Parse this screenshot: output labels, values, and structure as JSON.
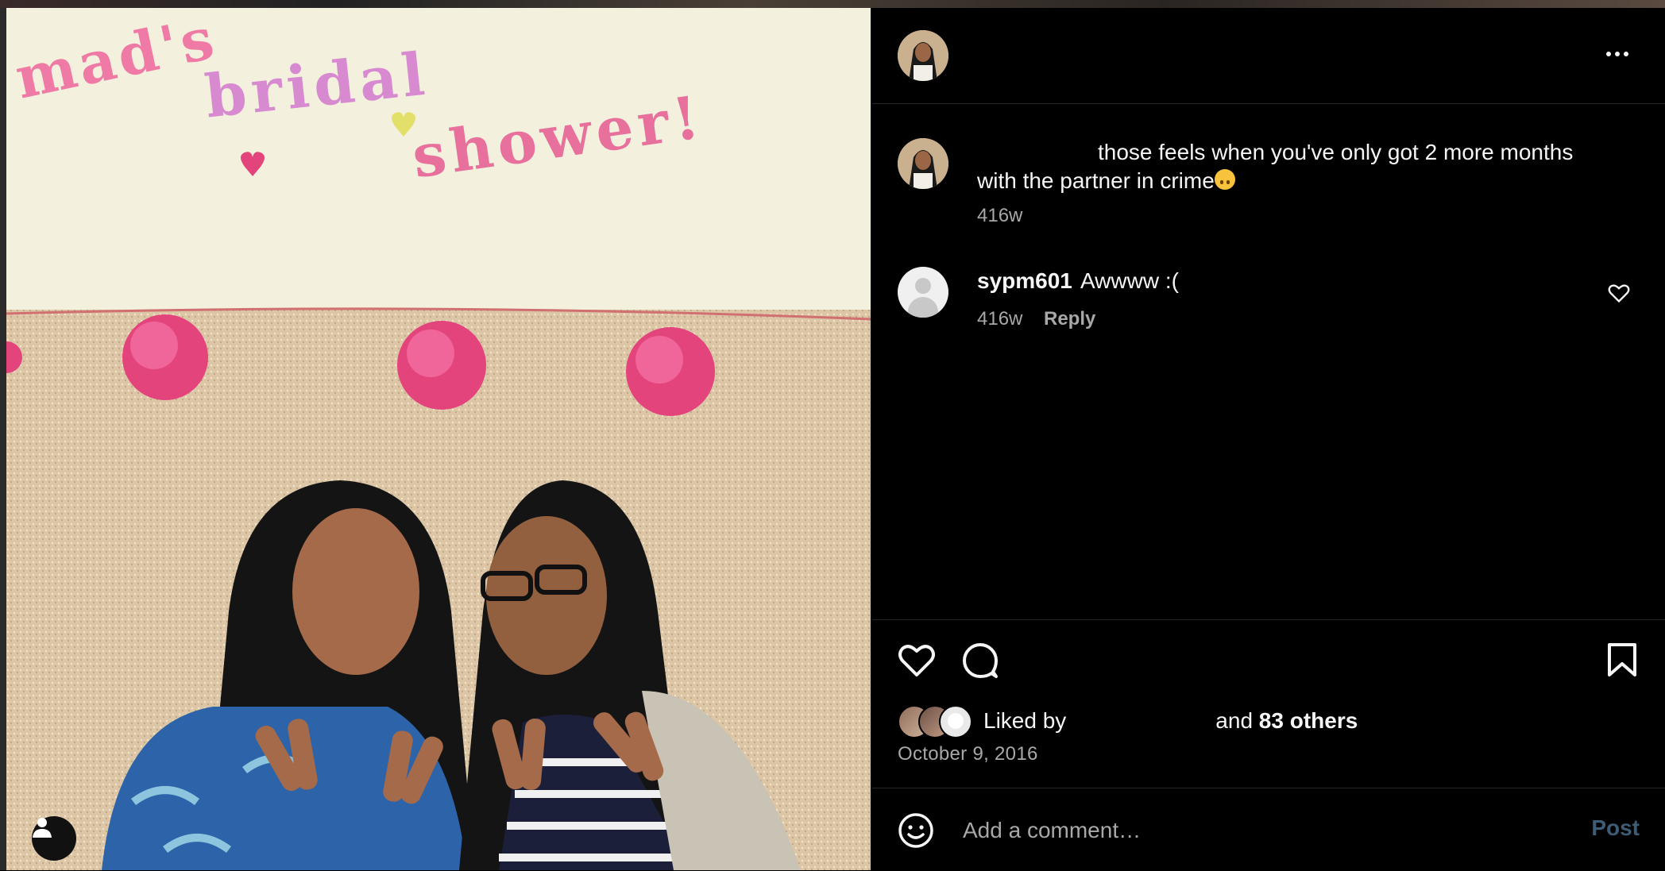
{
  "photo": {
    "banner_words": [
      "mad's",
      "bridal",
      "shower!"
    ],
    "owner_button_icon": "person-icon"
  },
  "post_header": {
    "avatar_icon": "profile-avatar",
    "more_icon": "more-options-icon"
  },
  "caption": {
    "text": "those feels when you've only got 2 more months with the partner in crime",
    "emoji": "upside-down-face",
    "time": "416w"
  },
  "comments": [
    {
      "username": "sypm601",
      "text": "Awwww :(",
      "time": "416w",
      "reply_label": "Reply"
    }
  ],
  "actions": {
    "like_icon": "heart-icon",
    "comment_icon": "comment-icon",
    "save_icon": "bookmark-icon"
  },
  "likes": {
    "prefix": "Liked by",
    "and_text": "and",
    "others": "83 others"
  },
  "date": "October 9, 2016",
  "comment_box": {
    "placeholder": "Add a comment…",
    "post_label": "Post"
  },
  "colors": {
    "background": "#000000",
    "text": "#f5f5f5",
    "muted": "#a8a8a8",
    "post_disabled": "#3e5c76",
    "divider": "#262626"
  }
}
